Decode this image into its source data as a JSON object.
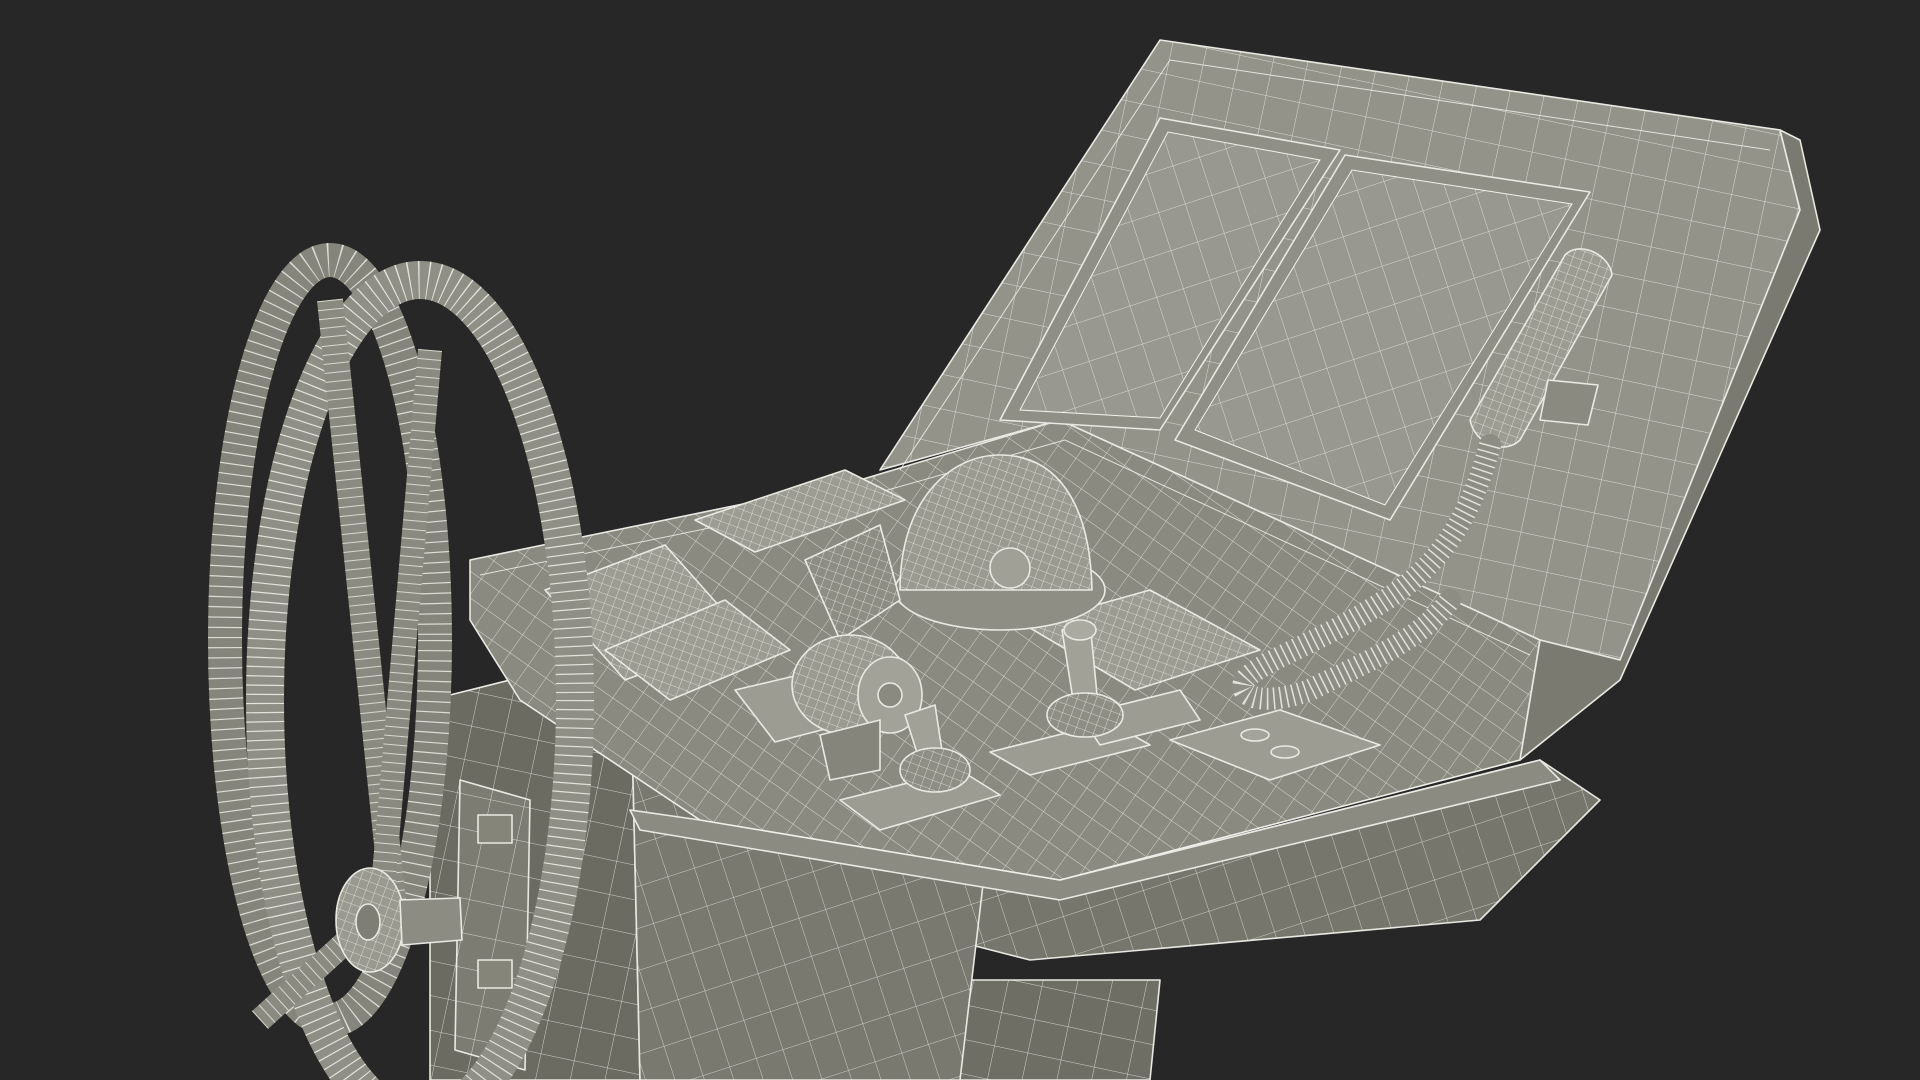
{
  "scene": {
    "subject": "marine-helm-console-wireframe",
    "colors": {
      "background": "#272727",
      "surface": "#8a8a80",
      "surface_dark": "#6f6f66",
      "surface_light": "#9a9a90",
      "wire": "#f2f2ec"
    },
    "parts": [
      "console-body",
      "console-top-panel",
      "display-screen-left",
      "display-screen-right",
      "throttle-lever",
      "joystick-left",
      "joystick-right",
      "helmet-compass",
      "handset-phone",
      "coiled-cable",
      "steering-wheel",
      "wheel-hub",
      "side-access-panel",
      "switch-panels"
    ]
  }
}
